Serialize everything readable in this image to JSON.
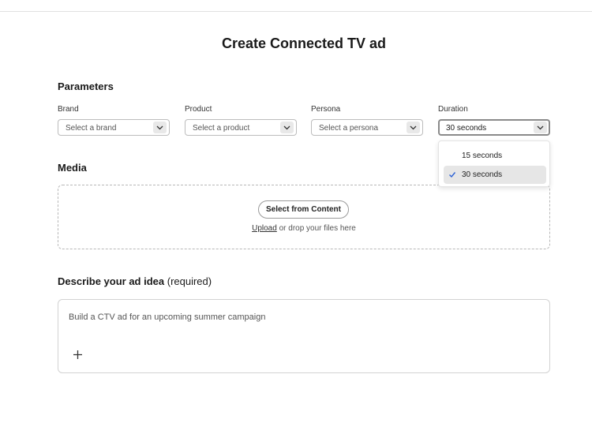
{
  "page": {
    "title": "Create Connected TV ad"
  },
  "parameters": {
    "heading": "Parameters",
    "fields": {
      "brand": {
        "label": "Brand",
        "value": "Select a brand"
      },
      "product": {
        "label": "Product",
        "value": "Select a product"
      },
      "persona": {
        "label": "Persona",
        "value": "Select a persona"
      },
      "duration": {
        "label": "Duration",
        "value": "30 seconds"
      }
    },
    "duration_options": [
      {
        "label": "15 seconds",
        "selected": false
      },
      {
        "label": "30 seconds",
        "selected": true
      }
    ]
  },
  "media": {
    "heading": "Media",
    "select_button": "Select from Content",
    "upload_link": "Upload",
    "upload_rest": " or drop your files here"
  },
  "idea": {
    "heading": "Describe your ad idea",
    "heading_suffix": " (required)",
    "prompt_text": "Build a CTV ad for an upcoming summer campaign"
  },
  "icons": {
    "select_chevron": "chevron-down-icon",
    "selected_check": "checkmark-icon",
    "add": "plus-icon"
  },
  "colors": {
    "accent": "#2c62d6",
    "selected_bg": "#e6e6e6"
  }
}
